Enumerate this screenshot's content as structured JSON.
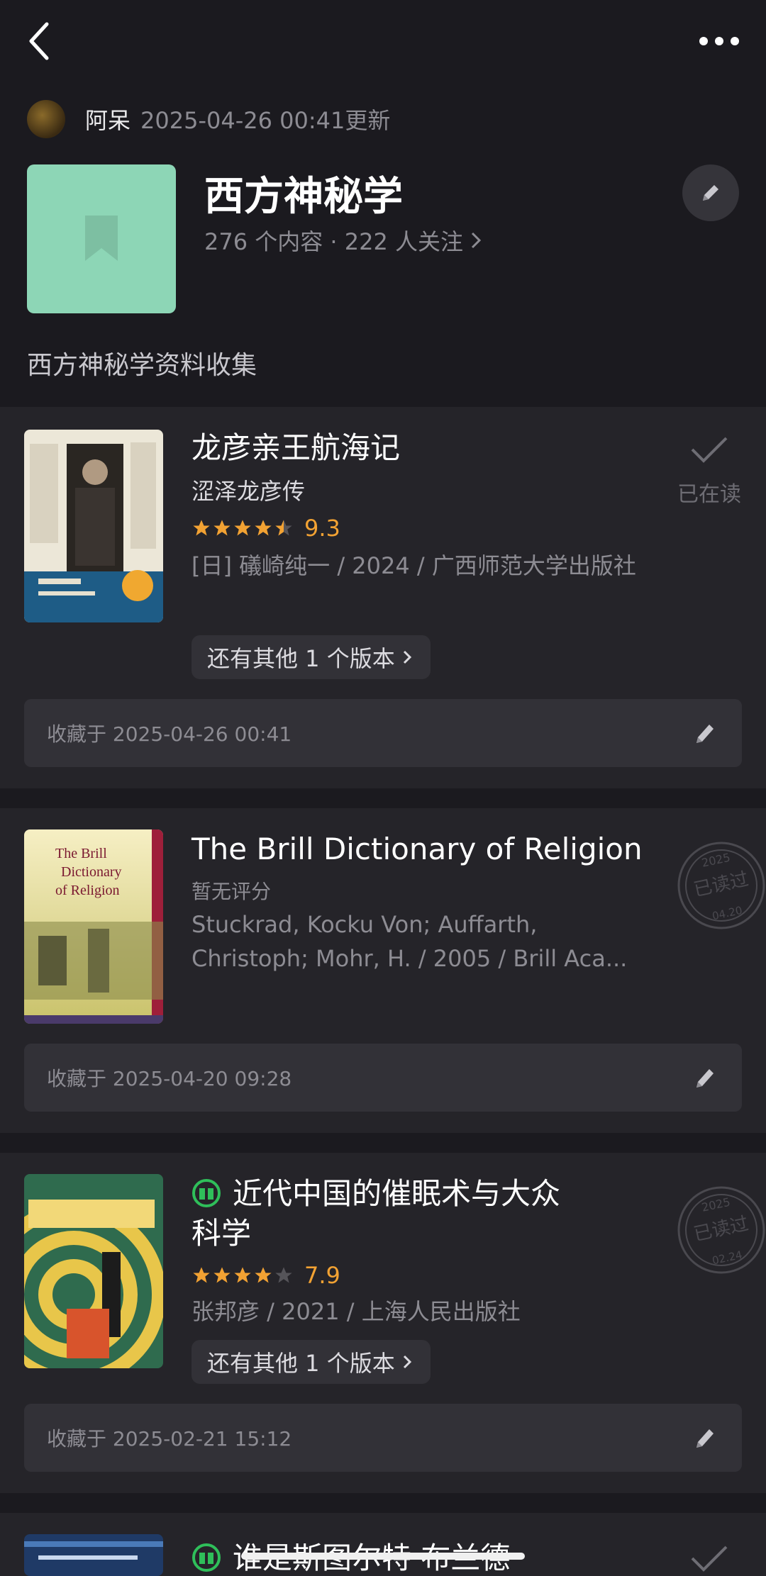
{
  "nav": {
    "back_icon": "chevron-left-icon",
    "more_icon": "more-dots-icon"
  },
  "header": {
    "author_name": "阿呆",
    "update_text": "2025-04-26 00:41更新",
    "list_title": "西方神秘学",
    "stats": "276 个内容 · 222 人关注",
    "description": "西方神秘学资料收集",
    "cover_color": "#8dd6b6"
  },
  "books": [
    {
      "title": "龙彦亲王航海记",
      "subtitle": "涩泽龙彦传",
      "rating": 9.3,
      "rating_text": "9.3",
      "meta": "[日] 礒崎纯一 / 2024 / 广西师范大学出版社",
      "version_label": "还有其他 1 个版本",
      "status_label": "已在读",
      "collected": "收藏于 2025-04-26 00:41"
    },
    {
      "title": "The Brill Dictionary of Religion",
      "rating_text": "暂无评分",
      "meta": "Stuckrad, Kocku Von; Auffarth, Christoph; Mohr, H. / 2005 / Brill Aca...",
      "cover_lines": [
        "The Brill",
        "Dictionary",
        "of Religion"
      ],
      "stamp": {
        "year": "2025",
        "label": "已读过",
        "date": "04.20"
      },
      "collected": "收藏于 2025-04-20 09:28"
    },
    {
      "title_line1": "近代中国的催眠术与大众",
      "title_line2": "科学",
      "rating": 7.9,
      "rating_text": "7.9",
      "meta": "张邦彦 / 2021 / 上海人民出版社",
      "version_label": "还有其他 1 个版本",
      "stamp": {
        "year": "2025",
        "label": "已读过",
        "date": "02.24"
      },
      "collected": "收藏于 2025-02-21 15:12"
    },
    {
      "title": "谁是斯图尔特·布兰德"
    }
  ],
  "colors": {
    "accent_star": "#f2a233",
    "wechat_read_green": "#2fbf5a",
    "background": "#1b1a1f",
    "card": "#252429"
  }
}
